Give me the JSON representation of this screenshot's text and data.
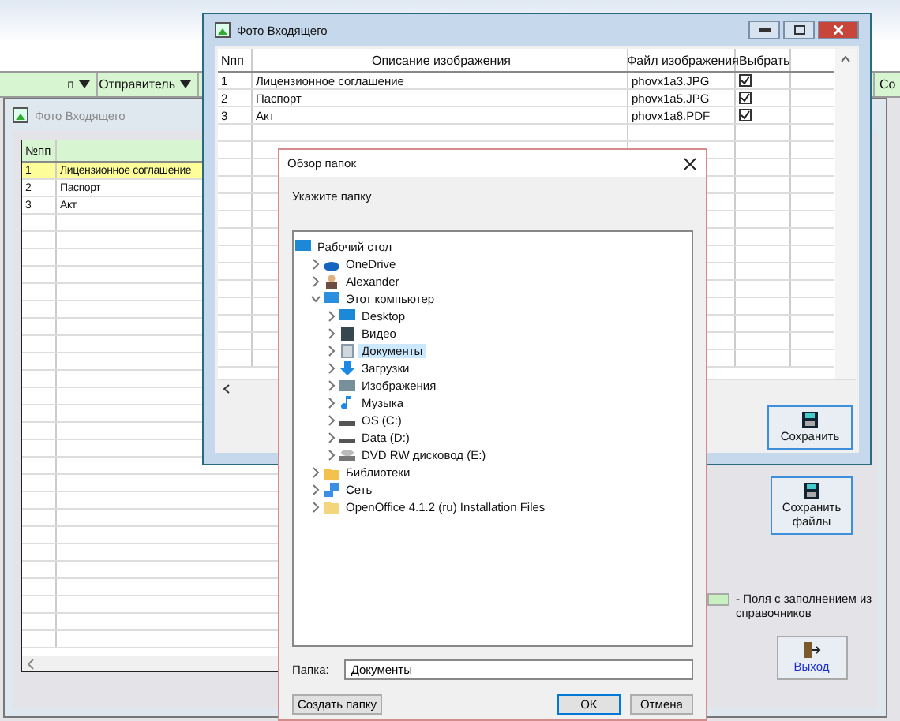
{
  "main": {
    "header_columns": [
      {
        "label": "п"
      },
      {
        "label": "Отправитель"
      },
      {
        "label": "Со"
      }
    ]
  },
  "back_window": {
    "title": "Фото Входящего",
    "columns": [
      "№пп"
    ],
    "rows": [
      {
        "num": "1",
        "text": "Лицензионное соглашение",
        "selected": true
      },
      {
        "num": "2",
        "text": "Паспорт",
        "selected": false
      },
      {
        "num": "3",
        "text": "Акт",
        "selected": false
      }
    ],
    "save_files_button": "Сохранить файлы",
    "legend": "- Поля с заполнением из справочников",
    "exit_button": "Выход"
  },
  "middle_window": {
    "title": "Фото Входящего",
    "columns": [
      "Nпп",
      "Описание изображения",
      "Файл изображения",
      "Выбрать"
    ],
    "rows": [
      {
        "num": "1",
        "description": "Лицензионное соглашение",
        "file": "phovx1a3.JPG",
        "checked": true
      },
      {
        "num": "2",
        "description": "Паспорт",
        "file": "phovx1a5.JPG",
        "checked": true
      },
      {
        "num": "3",
        "description": "Акт",
        "file": "phovx1a8.PDF",
        "checked": true
      }
    ],
    "save_button": "Сохранить"
  },
  "dialog": {
    "title": "Обзор папок",
    "prompt": "Укажите папку",
    "tree": [
      {
        "label": "Рабочий стол",
        "kind": "desktop",
        "selected": false,
        "children": [
          {
            "label": "OneDrive",
            "kind": "cloud",
            "expanded": false,
            "selected": false
          },
          {
            "label": "Alexander",
            "kind": "user",
            "expanded": false,
            "selected": false
          },
          {
            "label": "Этот компьютер",
            "kind": "computer",
            "expanded": true,
            "selected": false,
            "children": [
              {
                "label": "Desktop",
                "kind": "desktop",
                "expanded": false,
                "selected": false
              },
              {
                "label": "Видео",
                "kind": "video",
                "expanded": false,
                "selected": false
              },
              {
                "label": "Документы",
                "kind": "documents",
                "expanded": false,
                "selected": true
              },
              {
                "label": "Загрузки",
                "kind": "download",
                "expanded": false,
                "selected": false
              },
              {
                "label": "Изображения",
                "kind": "pictures",
                "expanded": false,
                "selected": false
              },
              {
                "label": "Музыка",
                "kind": "music",
                "expanded": false,
                "selected": false
              },
              {
                "label": "OS (C:)",
                "kind": "drive",
                "expanded": false,
                "selected": false
              },
              {
                "label": "Data (D:)",
                "kind": "drive",
                "expanded": false,
                "selected": false
              },
              {
                "label": "DVD RW дисковод (E:)",
                "kind": "dvd",
                "expanded": false,
                "selected": false
              }
            ]
          },
          {
            "label": "Библиотеки",
            "kind": "library",
            "expanded": false,
            "selected": false
          },
          {
            "label": "Сеть",
            "kind": "network",
            "expanded": false,
            "selected": false
          },
          {
            "label": "OpenOffice 4.1.2 (ru) Installation Files",
            "kind": "folder",
            "expanded": false,
            "selected": false
          }
        ]
      }
    ],
    "folder_label": "Папка:",
    "folder_value": "Документы",
    "create_folder_button": "Создать папку",
    "ok_button": "OK",
    "cancel_button": "Отмена"
  }
}
